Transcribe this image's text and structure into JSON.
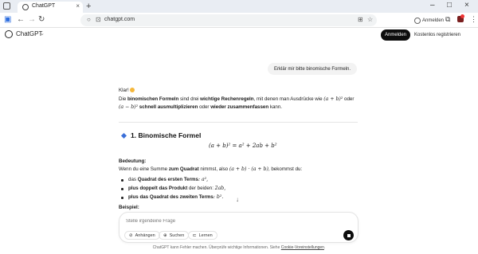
{
  "browser": {
    "tab_title": "ChatGPT",
    "url": "chatgpt.com",
    "profile_label": "Anmelden"
  },
  "header": {
    "brand": "ChatGPT",
    "login_label": "Anmelden",
    "signup_label": "Kostenlos registrieren"
  },
  "conversation": {
    "user_message": "Erklär mir bitte binomische Formeln.",
    "greeting": "Klar!",
    "intro_1": "Die ",
    "intro_b1": "binomischen Formeln",
    "intro_2": " sind drei ",
    "intro_b2": "wichtige Rechenregeln",
    "intro_3": ", mit denen man Ausdrücke wie ",
    "intro_m1": "(a + b)²",
    "intro_4": " oder",
    "intro2_m": "(a − b)²",
    "intro2_b1": " schnell ausmultiplizieren",
    "intro2_1": " oder ",
    "intro2_b2": "wieder zusammenfassen",
    "intro2_2": " kann.",
    "section_title": "1. Binomische Formel",
    "formula": "(a + b)² = a² + 2ab + b²",
    "meaning_label": "Bedeutung:",
    "meaning_1": "Wenn du eine Summe ",
    "meaning_b": "zum Quadrat",
    "meaning_2": " nimmst, also ",
    "meaning_m": "(a + b) · (a + b)",
    "meaning_3": ", bekommst du:",
    "b1_1": "das ",
    "b1_b": "Quadrat des ersten Terms",
    "b1_m": ": a²,",
    "b2_b": "plus doppelt das Produkt",
    "b2_1": " der beiden: ",
    "b2_m": "2ab,",
    "b3_b": "plus das Quadrat des zweiten Terms",
    "b3_m": ": b².",
    "example_label": "Beispiel:"
  },
  "composer": {
    "placeholder": "Stelle irgendeine Frage",
    "attach_label": "Anhängen",
    "search_label": "Suchen",
    "learn_label": "Lernen"
  },
  "footer": {
    "text": "ChatGPT kann Fehler machen. Überprüfe wichtige Informationen. Siehe ",
    "link": "Cookie-Voreinstellungen",
    "end": "."
  },
  "colors": {
    "accent_diamond": "#3b6fd8",
    "button_dark": "#0d0d0d"
  },
  "icons": [
    "chatgpt-logo-icon",
    "close-icon",
    "plus-icon",
    "back-icon",
    "forward-icon",
    "reload-icon",
    "lock-icon",
    "star-icon",
    "paperclip-icon",
    "globe-icon",
    "book-icon",
    "stop-icon",
    "arrow-down-icon"
  ]
}
